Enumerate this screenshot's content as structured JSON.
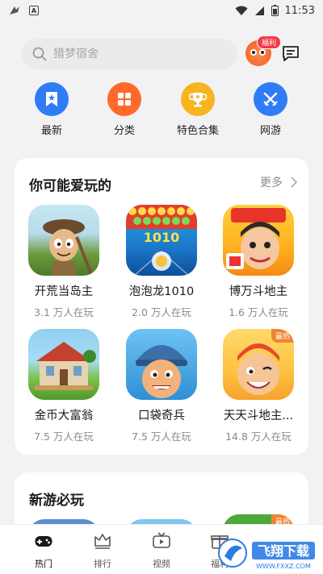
{
  "status": {
    "time": "11:53",
    "a_icon": "A"
  },
  "search": {
    "placeholder": "猎梦宿舍"
  },
  "header": {
    "welfare_badge": "福利"
  },
  "quick_nav": [
    {
      "label": "最新",
      "icon": "bookmark-icon",
      "color": "#2f7cf6"
    },
    {
      "label": "分类",
      "icon": "grid-icon",
      "color": "#ff6a2b"
    },
    {
      "label": "特色合集",
      "icon": "trophy-icon",
      "color": "#f6b51e"
    },
    {
      "label": "网游",
      "icon": "swords-icon",
      "color": "#2f7cf6"
    }
  ],
  "section_recommend": {
    "title": "你可能爱玩的",
    "more": "更多",
    "games": [
      {
        "name": "开荒当岛主",
        "players": "3.1 万人在玩"
      },
      {
        "name": "泡泡龙1010",
        "players": "2.0 万人在玩"
      },
      {
        "name": "博万斗地主",
        "players": "1.6 万人在玩"
      },
      {
        "name": "金币大富翁",
        "players": "7.5 万人在玩"
      },
      {
        "name": "口袋奇兵",
        "players": "7.5 万人在玩"
      },
      {
        "name": "天天斗地主...",
        "players": "14.8 万人在玩",
        "badge": "最热"
      }
    ]
  },
  "section_new": {
    "title": "新游必玩",
    "badge": "最热"
  },
  "bottom_nav": [
    {
      "label": "热门",
      "icon": "gamepad-icon",
      "active": true
    },
    {
      "label": "排行",
      "icon": "crown-icon",
      "active": false
    },
    {
      "label": "视频",
      "icon": "tv-icon",
      "active": false
    },
    {
      "label": "福利",
      "icon": "gift-icon",
      "active": false
    }
  ],
  "watermark": {
    "text": "飞翔下载",
    "url_text": "WWW.FXXZ.COM"
  }
}
